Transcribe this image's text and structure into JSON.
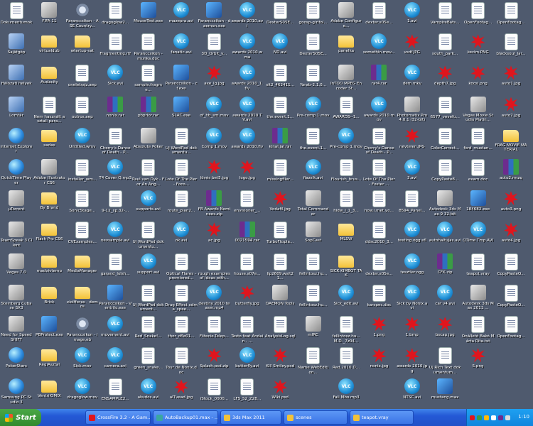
{
  "columns": [
    [
      "Dokumentumok",
      "Sajátgép",
      "Hálózati helyek",
      "Lomtár",
      "Internet Explorer",
      "QuickTime Player",
      "µTorrent",
      "TeamSpeak 3 Client",
      "Vegas 7.0",
      "Steinberg Cubase SX3",
      "Need for Speed SHIFT",
      "PokerStars",
      "Samsung PC Studio 3"
    ],
    [
      "FIFA 11",
      "virtualdub",
      "Audacity",
      "Nem használt asztali para...",
      "sadas",
      "Adobe Illustrator CS6",
      "By Brand",
      "Flash Pro CS6",
      "madvivtemp",
      "Brick",
      "PBProtect.exe",
      "RégiAsztal",
      "VentrilOMIX"
    ],
    [
      "Paranccsikon - ASE Country...",
      "wtertup-sat",
      "oneletrajz.aep",
      "outros.aep",
      "Untitled.wmv",
      "installer_wm...",
      "SonicStage...",
      "CVExamples...",
      "MediaManager",
      "xiolfferas - demos",
      "Paranccsikon - image.eb",
      "Sick.mov",
      "dragoglow.mov"
    ],
    [
      "dragoglow2...",
      "Fragmenting.rtf",
      "Sick.avi",
      "nonix.rar",
      "Cherry's Dance of Death - P...",
      "T4 Cover Q.mp3",
      "9-12_sp.32-...",
      "nevsample.avi",
      "garand_lolsh...",
      "Paranccsikon - Ventrilo.exe",
      "movement.avi",
      "camera.avi",
      "ENSAMPLE2..."
    ],
    [
      "MouseTest.exe",
      "Paranccsikon - munka.doc",
      "sample.fragme...",
      "pbprior.rar",
      "Absolute Poker",
      "Paul van Dyk - For An Ang...",
      "supports.avi",
      "Új WordPad dokumentu...",
      "support.avi",
      "Új WordPad dokument...",
      "Red_Snake!...",
      "green_snake...",
      "akudos.avi"
    ],
    [
      "mazepra.avi",
      "fanatic.avi",
      "Paranccsikon - cf.exe",
      "SLAC.exe",
      "Új WordPad dokumentu...",
      "Lote Of The Pier - Foco...",
      "route_plan2...",
      "ok.avi",
      "Optical Flares - premiered...",
      "Drug Effect xdma_spee...",
      "thor_dfle01...",
      "Tour de Nonix.doc",
      "alTvead.jpg"
    ],
    [
      "Paranccsikon - daemon.exe",
      "3D_Orbit_v...",
      "axe_lg.jpg",
      "of_hb_sm.mov",
      "Comp 1.mov",
      "lövés bet5.jpg",
      "FB Awards Nominees.zip",
      "ac.jpg",
      "rough examples of ideas with...",
      "destiny 2010 teaser.mp4",
      "Fiitecie-Telep...",
      "Splash.psd.zip",
      "iStock_0000..."
    ],
    [
      "awards 2010.avi",
      "awards 2010.wma",
      "awards 2010_1.flv",
      "awards 2010 TV.avi",
      "awards 2010.flv",
      "logo.jpg",
      "envisioner_...",
      "0021594.rar",
      "house.s07e...",
      "butterfly.jpg",
      "Testo feat Andain - ...",
      "butterfly.avi",
      "LFS_S2_Z28..."
    ],
    [
      "DexterS05E...",
      "ND.avi",
      "sit2_462411...",
      "the.event.1...",
      "kinal.jal.rar",
      "missingfiler...",
      "Vodafil.jpg",
      "TurboFtopla...",
      "lip2609.wsit21...",
      "DAEMON Tools",
      "AnalysisLog.sql",
      "Kill Smiley.psd",
      "Wiki.psd"
    ],
    [
      "goosp-girlfol...",
      "DexterS05E...",
      "Yarab-2.1.0...",
      "Pre-comp 1.mov",
      "the.event.1...",
      "fiazsik.avi",
      "Total Commander",
      "SopCast",
      "fellintosz.hu...",
      "fellintosz.hu...",
      "mIRC",
      "Name WebEdition..."
    ],
    [
      "Adobe Configure...",
      "panelka",
      "InTOO MPEG Encoder St...",
      "AWARDS--1...",
      "Pre-comp 1.mov",
      "Flourish_brus...",
      "hidw_i_1_3...",
      "MLSW",
      "SICK KIMBOT TAK",
      "Sick_edit.avi",
      "fellintosz.hu... M.D._7z04...",
      "Red.2010.D...",
      "Fali Mbo.mp3"
    ],
    [
      "dexter.s05e...",
      "somethin.mov...",
      "rar4.rar",
      "awards 2010.mov",
      "Cherry's Dance of Death - P...",
      "Lote Of The Pier - Foster ...",
      "how.i.met.yo...",
      "ddsc2010_3...",
      "dexter.s05e...",
      "karspec.doc",
      "1.png",
      "nonix.jpg"
    ],
    [
      "1.avi",
      "vsdf.JPG",
      "dem.mkv",
      "Photomatix Pro 4.0.1 (32-bit)",
      "névtelen.JPG",
      "3.avi",
      "8594_Panel...",
      "testing.ogg.sfl",
      "tesztler.ogg",
      "Sick by Nonix.avi",
      "1.bmp",
      "awards 2010.jpg",
      "NTSC.avi"
    ],
    [
      "VampireBats...",
      "south_park...",
      "depth7.jpg",
      "6577_vevefu...",
      "ColorCorrect...",
      "CopyPaste8...",
      "Autodesk 3ds Max 9 32-bit",
      "autohaltujas.avi",
      "CFK.zip",
      "car v4.avi",
      "bscap.jpg",
      "Új Rich Text dokumentum...",
      "mustang.max"
    ],
    [
      "OpenFootag...",
      "kecim.PNG",
      "kocsi.png",
      "Vegas Movie Studio Platin...",
      "ford_mustan...",
      "exam.doc",
      "184682.exe",
      "QTime Tmp.AVI",
      "teapot.vray",
      "Autodesk 3ds Max 2011 ...",
      "Önállető Bakó Márta Rita.txt",
      "5.png"
    ],
    [
      "OpenFootag...",
      "blacksoul_lar...",
      "auto1.jpg",
      "auto2.jpg",
      "FRAG MOVIE MATERIAL",
      "auto2.rmzq",
      "auto3.png",
      "auto4.jpg",
      "CopyPasteO...",
      "CopyPasteO...",
      "OpenFootag..."
    ]
  ],
  "taskbar": {
    "start_label": "Start",
    "buttons": [
      "CrossFire 3.2 - A Gam...",
      "AutoBackup01.max - ...",
      "3ds Max 2011",
      "scenes",
      "teapot.vray"
    ],
    "clock": "1:10",
    "accent": "#2459d6"
  }
}
